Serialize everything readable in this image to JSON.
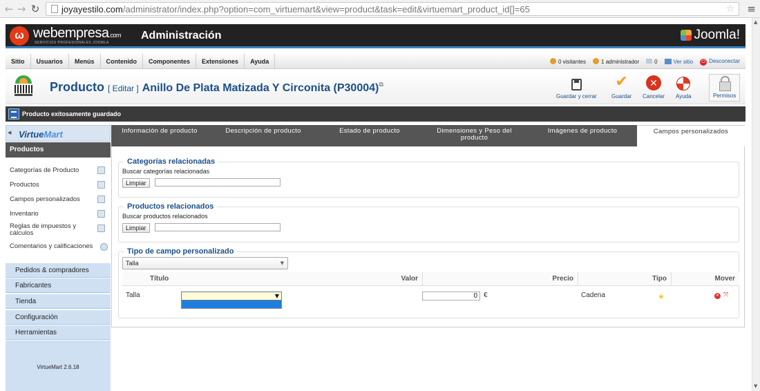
{
  "browser": {
    "url_host": "joyayestilo.com",
    "url_path": "/administrator/index.php?option=com_virtuemart&view=product&task=edit&virtuemart_product_id[]=65"
  },
  "header": {
    "brand": "webempresa",
    "brand_suffix": ".com",
    "brand_tagline": "SERVICIOS PROFESIONALES JOOMLA",
    "title": "Administración",
    "joomla_logo": "Joomla!"
  },
  "menubar": {
    "items": [
      "Sitio",
      "Usuarios",
      "Menús",
      "Contenido",
      "Componentes",
      "Extensiones",
      "Ayuda"
    ],
    "visitors": "0 visitantes",
    "admins": "1 administrador",
    "messages": "0",
    "view_site": "Ver sitio",
    "logout": "Desconectar"
  },
  "page": {
    "title": "Producto",
    "edit_tag": "[ Editar ]",
    "product_name": "Anillo De Plata Matizada Y Circonita (P30004)"
  },
  "toolbar": {
    "save_close": "Guardar y cerrar",
    "save": "Guardar",
    "cancel": "Cancelar",
    "help": "Ayuda",
    "permissions": "Permisos"
  },
  "message": "Producto exitosamente guardado",
  "sidebar": {
    "logo_a": "Virtue",
    "logo_b": "Mart",
    "section": "Productos",
    "items": [
      "Categorías de Producto",
      "Productos",
      "Campos personalizados",
      "Inventario",
      "Reglas de impuestos y cálculos",
      "Comentarios y calificaciones"
    ],
    "groups": [
      "Pedidos & compradores",
      "Fabricantes",
      "Tienda",
      "Configuración",
      "Herramientas"
    ],
    "version": "VirtueMart 2.6.18"
  },
  "tabs": [
    "Información de producto",
    "Descripción de producto",
    "Estado de producto",
    "Dimensiones y Peso del producto",
    "Imágenes de producto",
    "Campos personalizados"
  ],
  "related_categories": {
    "legend": "Categorías relacionadas",
    "label": "Buscar categorías relacionadas",
    "button": "Limpiar",
    "value": ""
  },
  "related_products": {
    "legend": "Productos relacionados",
    "label": "Buscar productos relacionados",
    "button": "Limpiar",
    "value": ""
  },
  "custom_field": {
    "legend": "Tipo de campo personalizado",
    "selected": "Talla",
    "headers": {
      "title": "Título",
      "value": "Valor",
      "price": "Precio",
      "type": "Tipo",
      "move": "Mover"
    },
    "row": {
      "title": "Talla",
      "value": "",
      "price": "0",
      "currency": "€",
      "type": "Cadena"
    }
  },
  "colors": {
    "accent_blue": "#3b83c5",
    "title_blue": "#1b4f8a",
    "dark_bar": "#3a3a3a"
  }
}
